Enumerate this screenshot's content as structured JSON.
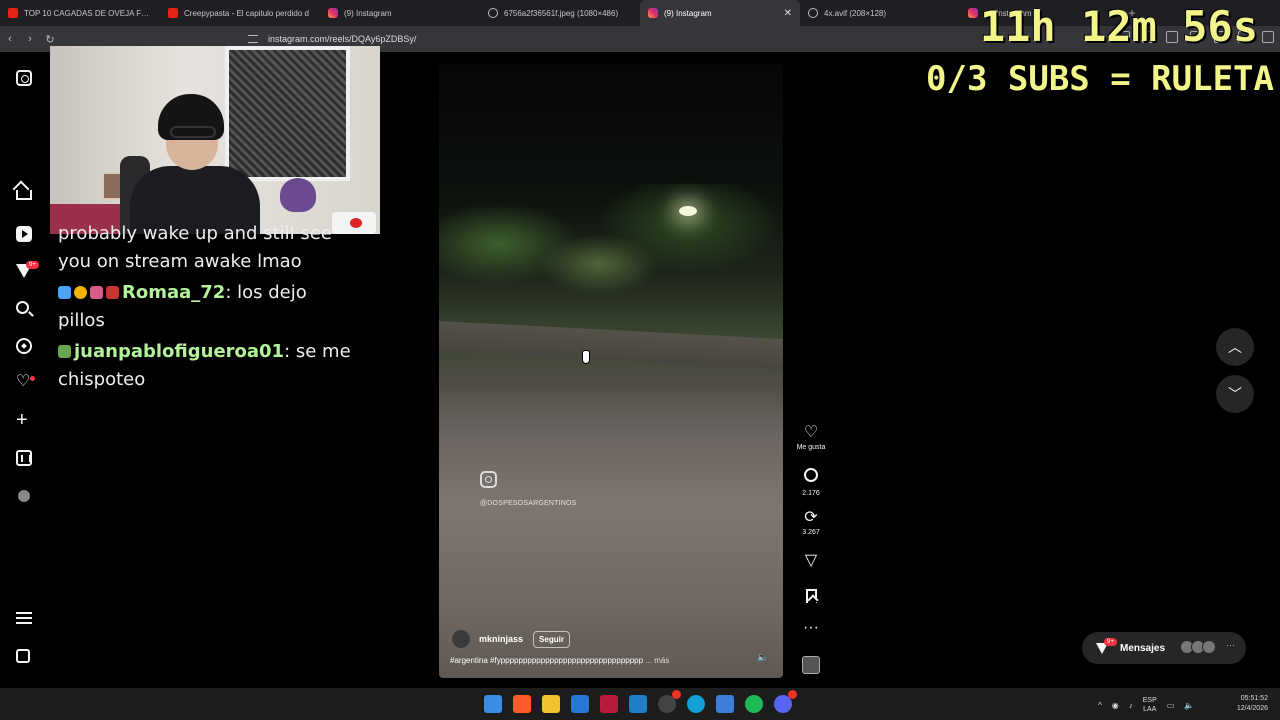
{
  "browser": {
    "tabs": [
      {
        "label": "TOP 10 CAGADAS DE OVEJA FREE F",
        "icon": "youtube-icon"
      },
      {
        "label": "Creepypasta - El capitulo perdido d",
        "icon": "youtube-icon"
      },
      {
        "label": "(9) Instagram",
        "icon": "instagram-icon"
      },
      {
        "label": "6756a2f36561f.jpeg (1080×486)",
        "icon": "globe-icon"
      },
      {
        "label": "(9) Instagram",
        "icon": "instagram-icon",
        "active": true
      },
      {
        "label": "4x.avif (208×128)",
        "icon": "globe-icon"
      },
      {
        "label": "(9) Instagram",
        "icon": "instagram-icon"
      }
    ],
    "url": "instagram.com/reels/DQAy6pZDBSy/"
  },
  "stream_overlay": {
    "timer": "11h 12m 56s",
    "subs_goal": "0/3 SUBS = RULETA"
  },
  "chat": [
    {
      "user": "",
      "text": "probably wake up and still see you on stream awake lmao"
    },
    {
      "user": "Romaa_72",
      "text": ": los dejo pillos"
    },
    {
      "user": "juanpablofigueroa01",
      "text": ": se me chispoteo"
    }
  ],
  "reel": {
    "watermark": "@DOSPESOSARGENTINOS",
    "author": "mkninjass",
    "follow_label": "Seguir",
    "caption": "#argentina #fypppppppppppppppppppppppppppppppp",
    "more_label": "... más"
  },
  "actions": {
    "like_label": "Me gusta",
    "comments_count": "2.176",
    "reposts_count": "3.267"
  },
  "messages": {
    "label": "Mensajes",
    "badge": "9+"
  },
  "sidebar": {
    "notifications_badge": "9+"
  },
  "taskbar": {
    "lang_top": "ESP",
    "lang_bottom": "LAA",
    "time": "05:51:52",
    "date": "12/4/2026"
  },
  "colors": {
    "overlay_text": "#f3f58a",
    "chat_username": "#b2f29b",
    "badge_red": "#ff3040"
  }
}
